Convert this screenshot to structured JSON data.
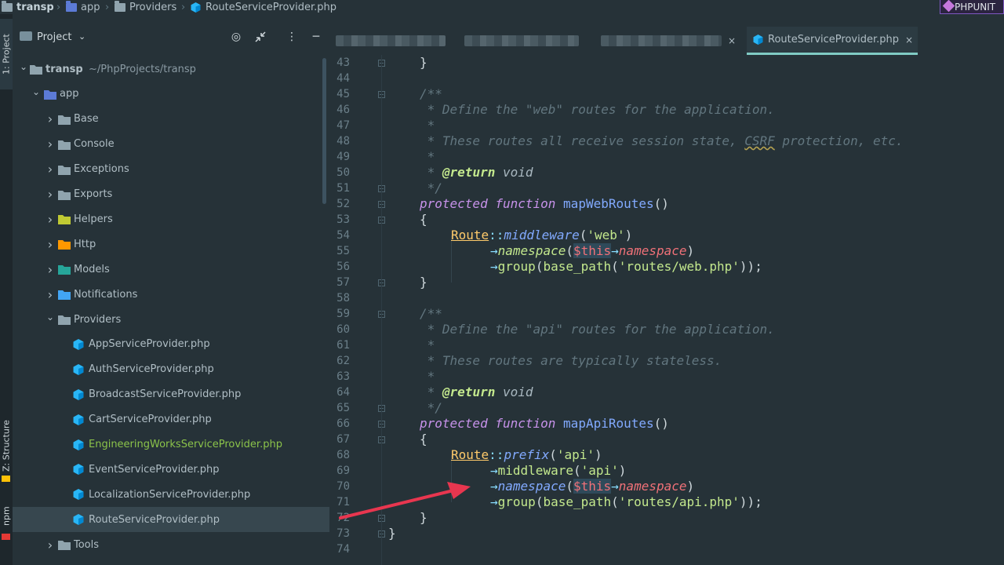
{
  "breadcrumb": {
    "project": "transp",
    "folder1": "app",
    "folder2": "Providers",
    "file": "RouteServiceProvider.php"
  },
  "badge": {
    "label": "PHPUNIT"
  },
  "tool_strip": {
    "project_label": "1: Project",
    "structure_label": "Z: Structure",
    "npm_label": "npm"
  },
  "project_panel": {
    "title": "Project",
    "tree": [
      {
        "label": "transp",
        "sub": "~/PhpProjects/transp"
      },
      {
        "label": "app"
      },
      {
        "label": "Base"
      },
      {
        "label": "Console"
      },
      {
        "label": "Exceptions"
      },
      {
        "label": "Exports"
      },
      {
        "label": "Helpers"
      },
      {
        "label": "Http"
      },
      {
        "label": "Models"
      },
      {
        "label": "Notifications"
      },
      {
        "label": "Providers"
      },
      {
        "label": "AppServiceProvider.php"
      },
      {
        "label": "AuthServiceProvider.php"
      },
      {
        "label": "BroadcastServiceProvider.php"
      },
      {
        "label": "CartServiceProvider.php"
      },
      {
        "label": "EngineeringWorksServiceProvider.php"
      },
      {
        "label": "EventServiceProvider.php"
      },
      {
        "label": "LocalizationServiceProvider.php"
      },
      {
        "label": "RouteServiceProvider.php"
      },
      {
        "label": "Tools"
      }
    ]
  },
  "tabs": {
    "active_label": "RouteServiceProvider.php",
    "close": "×"
  },
  "editor": {
    "line_numbers": [
      "43",
      "44",
      "45",
      "46",
      "47",
      "48",
      "49",
      "50",
      "51",
      "52",
      "53",
      "54",
      "55",
      "56",
      "57",
      "58",
      "59",
      "60",
      "61",
      "62",
      "63",
      "64",
      "65",
      "66",
      "67",
      "68",
      "69",
      "70",
      "71",
      "72",
      "73",
      "74"
    ],
    "code": {
      "l43_brace": "}",
      "l45_open": "/**",
      "l46": " * Define the \"web\" routes for the application.",
      "l47": " *",
      "l48a": " * These routes all receive session state, ",
      "l48b": "CSRF",
      "l48c": " protection, etc.",
      "l49": " *",
      "l50_star": " * ",
      "l50_tag": "@return",
      "l50_type": " void",
      "l51": " */",
      "kw_protected": "protected",
      "kw_function": "function",
      "fn_web": "mapWebRoutes",
      "parens": "()",
      "open_brace": "{",
      "close_brace": "}",
      "route": "Route",
      "dcolon": "::",
      "middleware": "middleware",
      "str_web": "'web'",
      "arrow": "→",
      "namespace": "namespace",
      "this": "$this",
      "group": "group",
      "base_path": "base_path",
      "str_webphp": "'routes/web.php'",
      "close_paren": ")",
      "close_call": "));",
      "open_paren": "(",
      "l60": " * Define the \"api\" routes for the application.",
      "l62": " * These routes are typically stateless.",
      "fn_api": "mapApiRoutes",
      "prefix": "prefix",
      "str_api": "'api'",
      "str_apiphp": "'routes/api.php'"
    }
  },
  "colors": {
    "annotation_arrow": "#e8364f",
    "accent": "#80cbc4"
  }
}
